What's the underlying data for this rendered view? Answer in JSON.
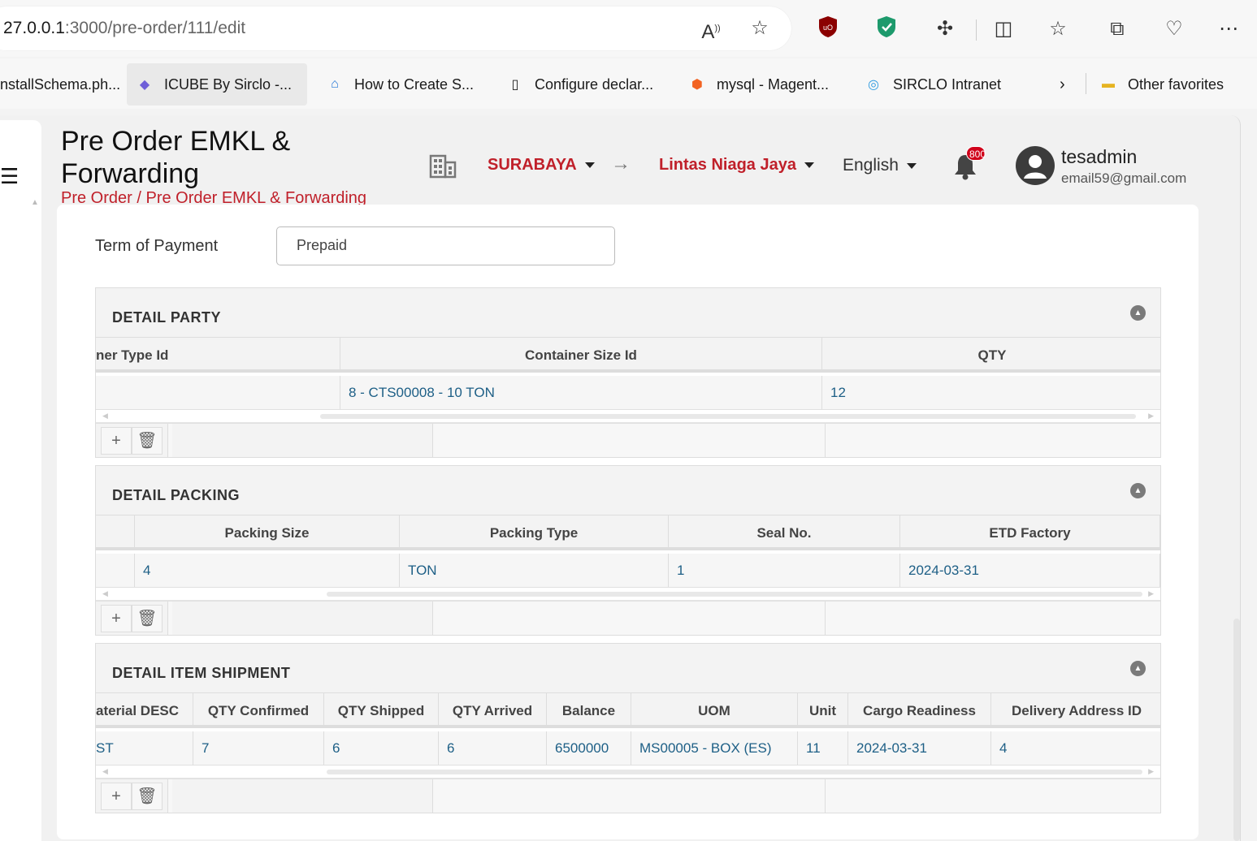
{
  "browser": {
    "url_prefix": "27.0.0.1",
    "url_rest": ":3000/pre-order/111/edit",
    "read_aloud_icon": "read-aloud-icon",
    "favorite_icon": "star-icon",
    "favorites": [
      {
        "label": "installSchema.ph...",
        "icon": "page-icon"
      },
      {
        "label": "ICUBE By Sirclo -...",
        "icon": "diamond-icon"
      },
      {
        "label": "How to Create S...",
        "icon": "house-icon"
      },
      {
        "label": "Configure declar...",
        "icon": "document-icon"
      },
      {
        "label": "mysql - Magent...",
        "icon": "magento-icon"
      },
      {
        "label": "SIRCLO Intranet",
        "icon": "sirclo-icon"
      }
    ],
    "more_favorites_label": "Other favorites"
  },
  "header": {
    "title": "Pre Order EMKL & Forwarding",
    "breadcrumb": "Pre Order / Pre Order EMKL & Forwarding",
    "location": "SURABAYA",
    "company": "Lintas Niaga Jaya",
    "language": "English",
    "notifications": "800",
    "user_name": "tesadmin",
    "user_email": "email59@gmail.com"
  },
  "form": {
    "term_of_payment_label": "Term of Payment",
    "term_of_payment_value": "Prepaid"
  },
  "detail_party": {
    "title": "DETAIL PARTY",
    "columns": [
      "ner Type Id",
      "Container Size Id",
      "QTY"
    ],
    "rows": [
      [
        "",
        "8 - CTS00008 - 10 TON",
        "12"
      ]
    ]
  },
  "detail_packing": {
    "title": "DETAIL PACKING",
    "columns": [
      "",
      "Packing Size",
      "Packing Type",
      "Seal No.",
      "ETD Factory"
    ],
    "rows": [
      [
        "",
        "4",
        "TON",
        "1",
        "2024-03-31"
      ]
    ]
  },
  "detail_item_shipment": {
    "title": "DETAIL ITEM SHIPMENT",
    "columns": [
      "aterial DESC",
      "QTY Confirmed",
      "QTY Shipped",
      "QTY Arrived",
      "Balance",
      "UOM",
      "Unit",
      "Cargo Readiness",
      "Delivery Address ID"
    ],
    "rows": [
      [
        "ST",
        "7",
        "6",
        "6",
        "6500000",
        "MS00005 - BOX (ES)",
        "11",
        "2024-03-31",
        "4"
      ]
    ]
  },
  "grid_footer": {
    "add_label": "+",
    "delete_icon": "trash-icon"
  }
}
